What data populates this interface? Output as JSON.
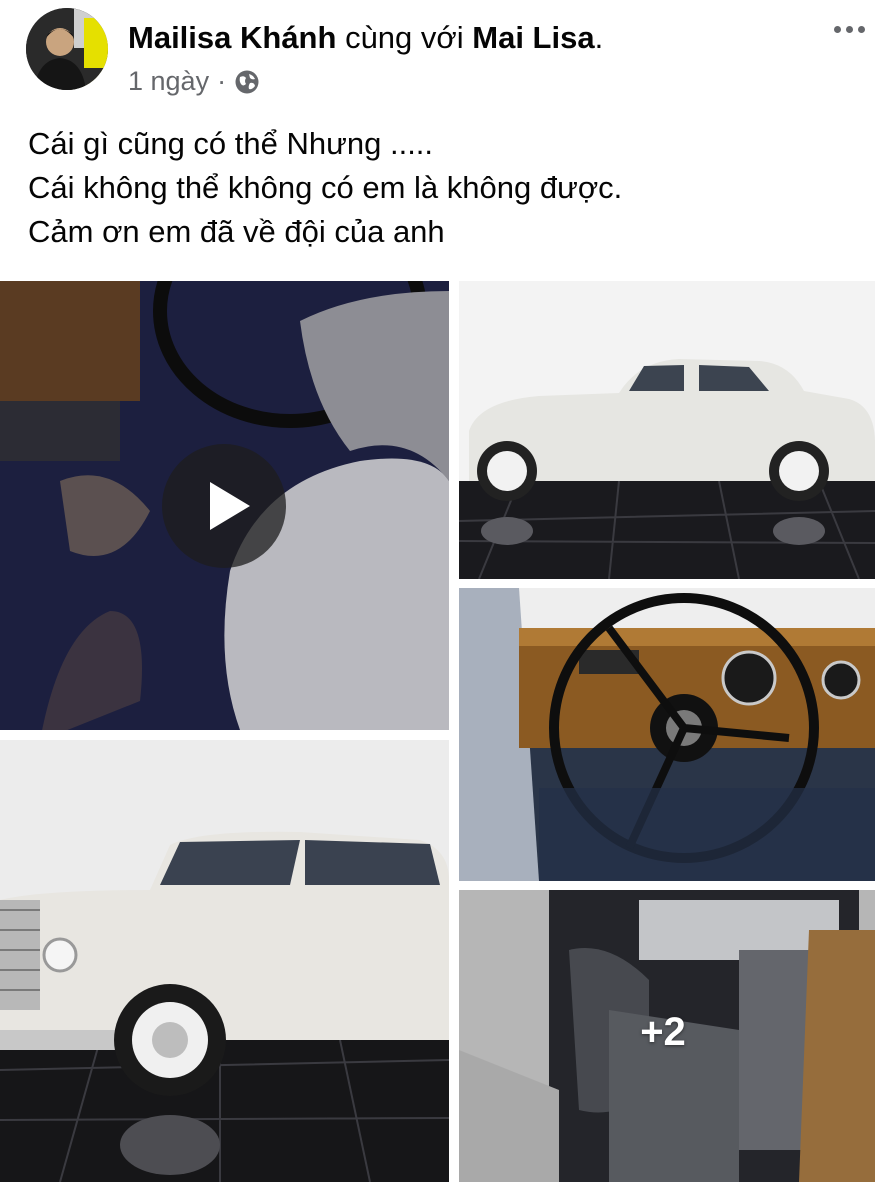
{
  "post": {
    "author": "Mailisa Khánh",
    "with_text": "cùng với",
    "tagged": "Mai Lisa",
    "period": ".",
    "time": "1 ngày",
    "separator": "·",
    "audience_icon": "globe-icon",
    "more_icon": "more-options-icon",
    "text_lines": [
      "Cái gì cũng có thể Nhưng .....",
      "Cái không thể không có em là không được.",
      "Cảm ơn em đã về đội của anh"
    ]
  },
  "media": {
    "video_play_icon": "play-icon",
    "more_count": "+2",
    "photos": [
      "video-interior-seat",
      "white-classic-sedan-side",
      "dashboard-steering-wheel",
      "white-classic-sedan-front",
      "rear-seat-interior"
    ]
  },
  "colors": {
    "text_primary": "#050505",
    "text_secondary": "#65676b",
    "background": "#ffffff"
  }
}
